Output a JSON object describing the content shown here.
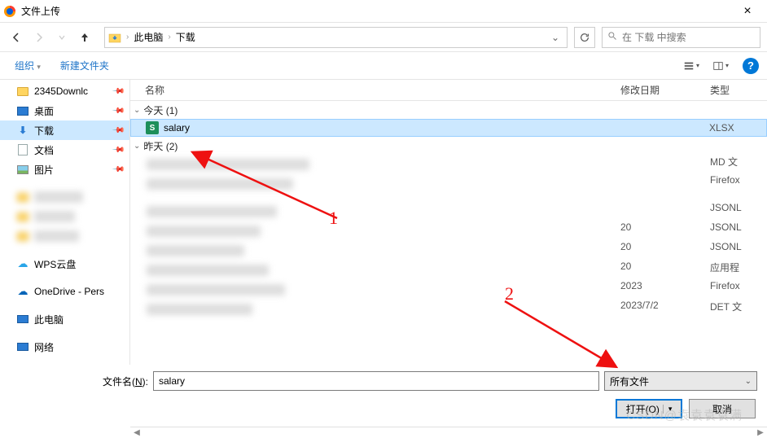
{
  "window": {
    "title": "文件上传",
    "close": "×"
  },
  "nav": {
    "breadcrumb": {
      "item1": "此电脑",
      "item2": "下载"
    },
    "search_placeholder": "在 下载 中搜索"
  },
  "toolbar": {
    "organize": "组织",
    "new_folder": "新建文件夹",
    "help": "?"
  },
  "sidebar": {
    "items": [
      {
        "label": "2345Downlc",
        "icon": "folder",
        "pinned": true
      },
      {
        "label": "桌面",
        "icon": "desktop",
        "pinned": true
      },
      {
        "label": "下载",
        "icon": "downloads",
        "pinned": true,
        "selected": true
      },
      {
        "label": "文档",
        "icon": "document",
        "pinned": true
      },
      {
        "label": "图片",
        "icon": "pictures",
        "pinned": true
      },
      {
        "label": "WPS云盘",
        "icon": "wps-cloud"
      },
      {
        "label": "OneDrive - Pers",
        "icon": "onedrive"
      },
      {
        "label": "此电脑",
        "icon": "this-pc"
      },
      {
        "label": "网络",
        "icon": "network"
      }
    ]
  },
  "columns": {
    "name": "名称",
    "date": "修改日期",
    "type": "类型"
  },
  "groups": {
    "today": {
      "label": "今天 (1)"
    },
    "yesterday": {
      "label": "昨天 (2)"
    }
  },
  "files": {
    "salary": {
      "name": "salary",
      "date": "",
      "type": "XLSX"
    }
  },
  "obscured_types": [
    "MD 文",
    "Firefox",
    "JSONL",
    "JSONL",
    "JSONL",
    "应用程",
    "Firefox",
    "DET 文"
  ],
  "obscured_dates": [
    "20",
    "20",
    "20",
    "2023",
    "2023/7/2"
  ],
  "footer": {
    "filename_label_pre": "文件名(",
    "filename_hotkey": "N",
    "filename_label_post": "):",
    "filename_value": "salary",
    "filetype": "所有文件",
    "open_btn": "打开(O)",
    "cancel_btn": "取消"
  },
  "annotations": {
    "label1": "1",
    "label2": "2"
  },
  "watermark": "CSDN@袁袁袁袁满"
}
